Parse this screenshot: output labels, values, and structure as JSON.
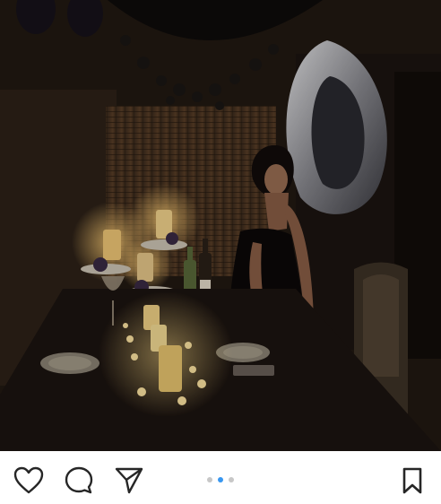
{
  "post": {
    "image_description": "",
    "carousel": {
      "total": 3,
      "active_index": 1
    }
  },
  "actions": {
    "like": {
      "icon": "heart-icon"
    },
    "comment": {
      "icon": "comment-icon"
    },
    "share": {
      "icon": "send-icon"
    },
    "save": {
      "icon": "bookmark-icon"
    }
  },
  "colors": {
    "dot_active": "#3897f0",
    "dot_inactive": "#c7c7c7",
    "icon_stroke": "#262626"
  }
}
